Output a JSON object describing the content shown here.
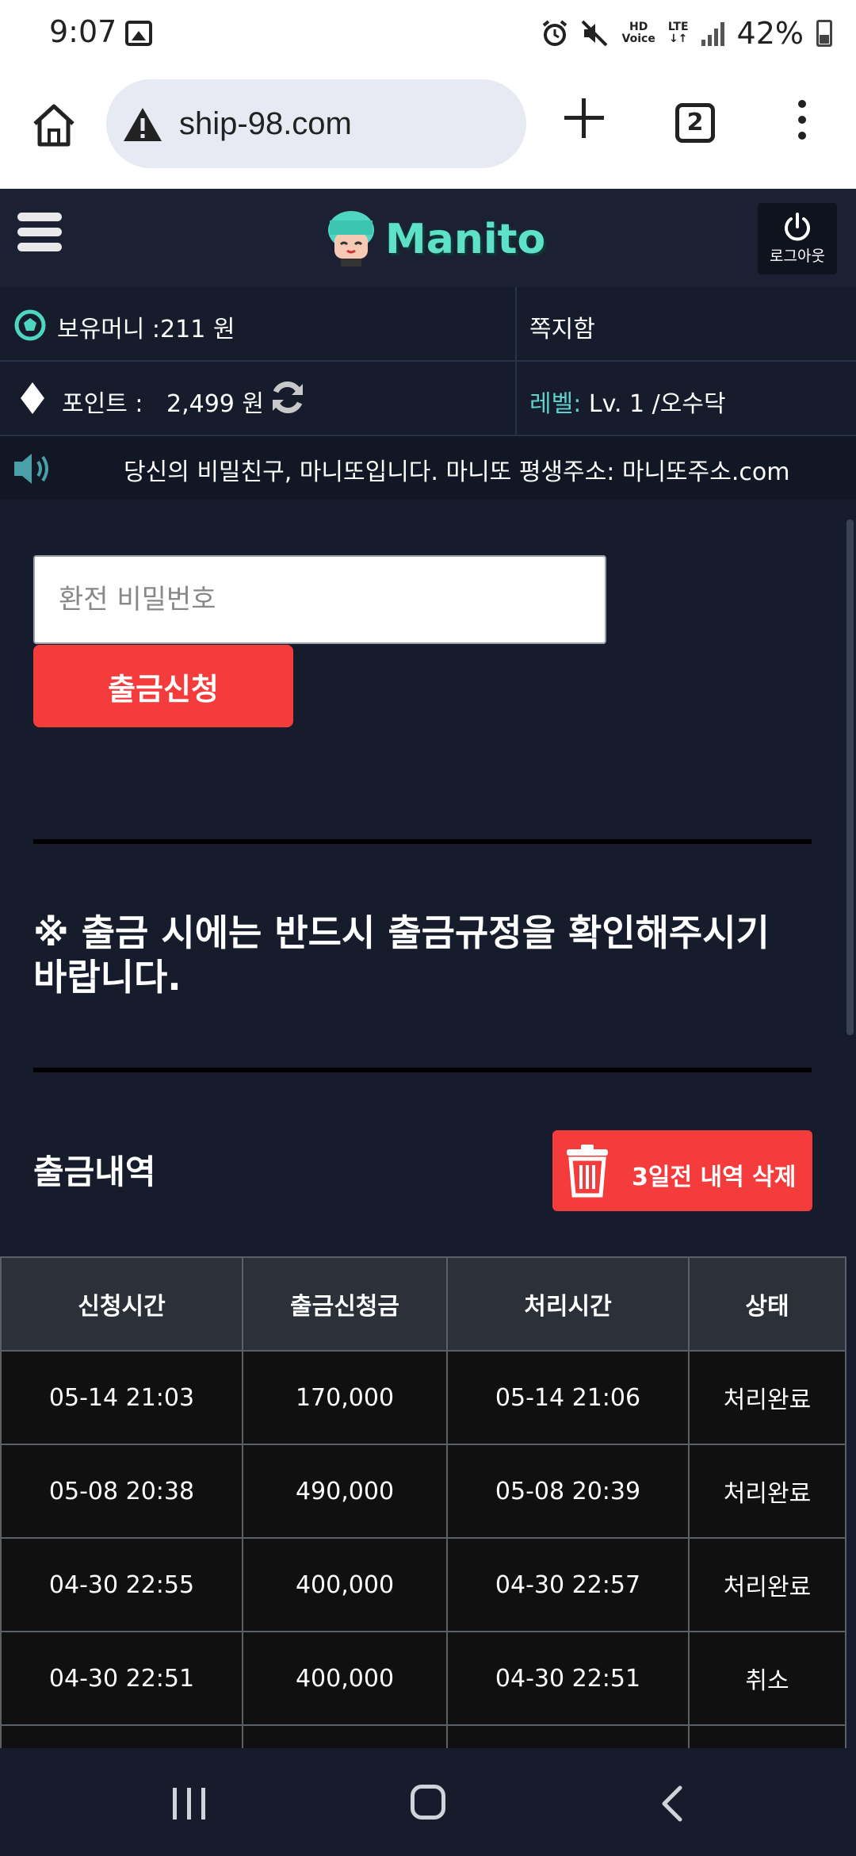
{
  "status_bar": {
    "time": "9:07",
    "hd_voice_line1": "HD",
    "hd_voice_line2": "Voice",
    "lte": "LTE",
    "battery": "42%"
  },
  "browser": {
    "url": "ship-98.com",
    "tab_count": "2"
  },
  "header": {
    "logo_text": "Manito",
    "logout_label": "로그아웃"
  },
  "info": {
    "money_label": "보유머니 :211 원",
    "messages_label": "쪽지함",
    "point_label": "포인트 :",
    "point_value": "2,499 원",
    "level_key": "레벨:",
    "level_value": " Lv. 1 /오수닥"
  },
  "notice": {
    "text": "당신의 비밀친구, 마니또입니다. 마니또 평생주소: 마니또주소.com"
  },
  "form": {
    "password_placeholder": "환전 비밀번호",
    "submit_label": "출금신청"
  },
  "rule_notice": "※ 출금 시에는 반드시 출금규정을 확인해주시기 바랍니다.",
  "history": {
    "title": "출금내역",
    "delete_label": "3일전 내역 삭제",
    "columns": [
      "신청시간",
      "출금신청금",
      "처리시간",
      "상태"
    ],
    "rows": [
      [
        "05-14 21:03",
        "170,000",
        "05-14 21:06",
        "처리완료"
      ],
      [
        "05-08 20:38",
        "490,000",
        "05-08 20:39",
        "처리완료"
      ],
      [
        "04-30 22:55",
        "400,000",
        "04-30 22:57",
        "처리완료"
      ],
      [
        "04-30 22:51",
        "400,000",
        "04-30 22:51",
        "취소"
      ]
    ]
  },
  "colors": {
    "accent_red": "#f43c3c",
    "background": "#171c2c",
    "level_teal": "#5fd0cc"
  }
}
